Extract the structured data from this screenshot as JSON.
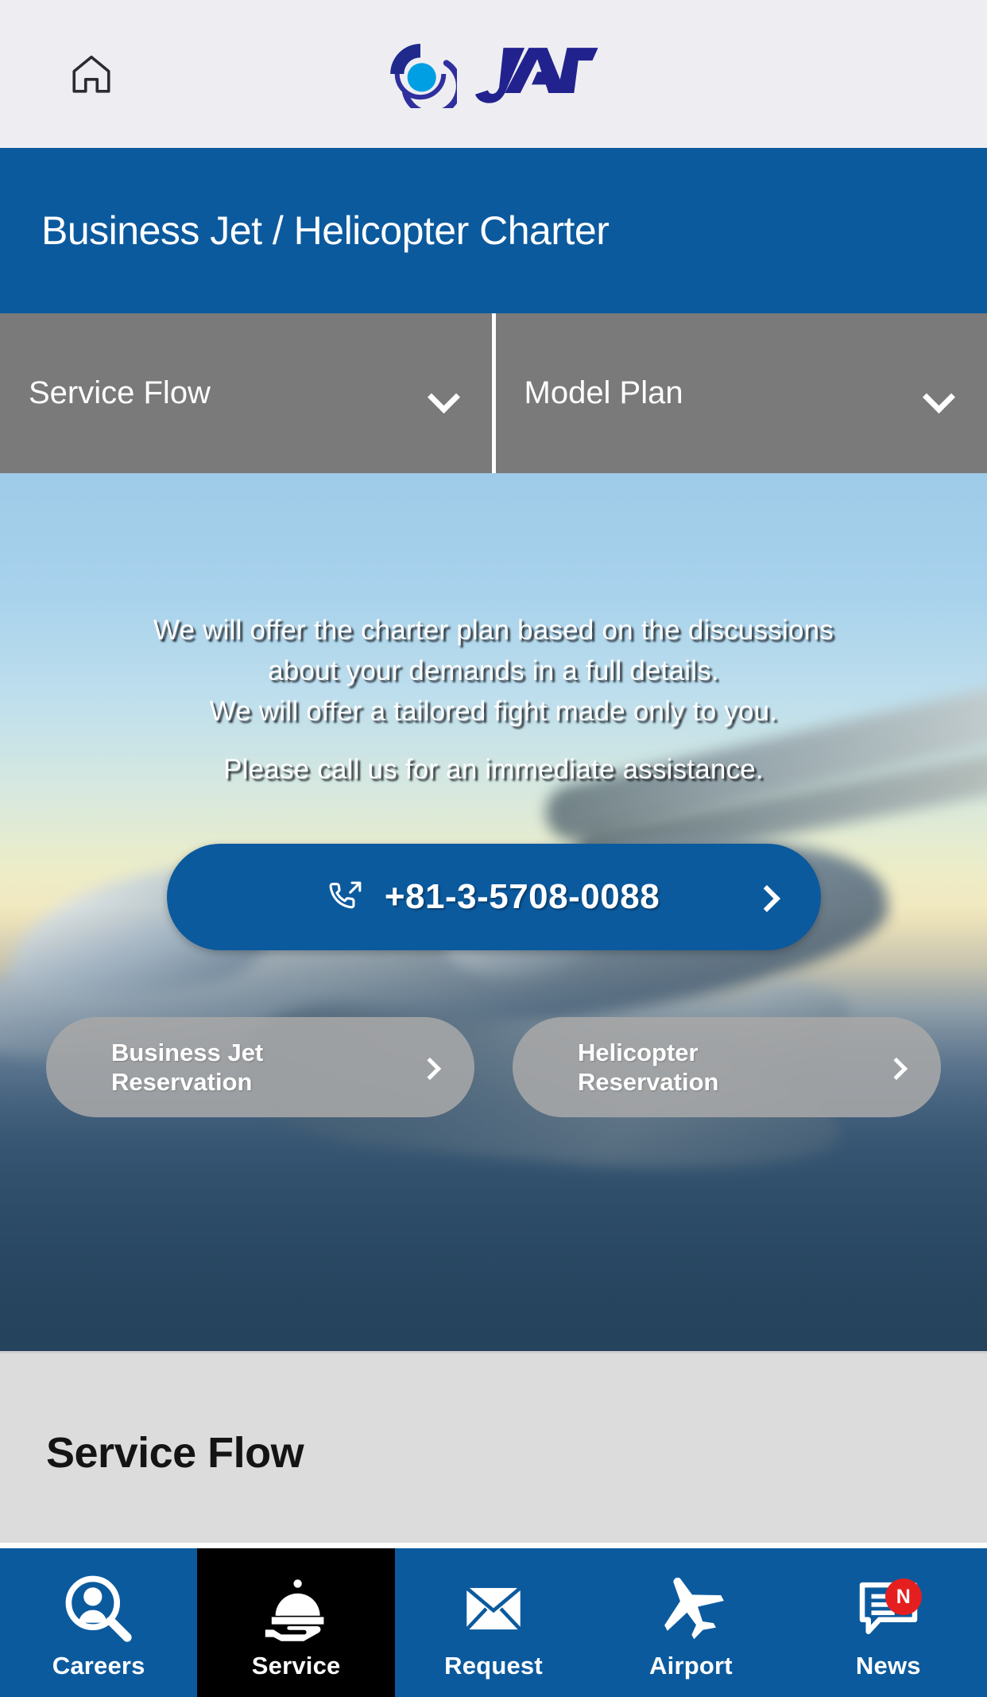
{
  "header": {
    "home_icon": "home-icon",
    "logo_alt": "JAN",
    "logo_mark_color": "#1f2a8c",
    "logo_dot_color": "#009fe3"
  },
  "page_title": "Business Jet / Helicopter Charter",
  "tabs": [
    {
      "label": "Service Flow",
      "icon": "chevron-down-icon"
    },
    {
      "label": "Model Plan",
      "icon": "chevron-down-icon"
    }
  ],
  "hero": {
    "line1": "We will offer the charter plan based on the discussions",
    "line2": "about your demands in a full details.",
    "line3": "We will offer a tailored fight made only to you.",
    "line4": "Please call us for an immediate assistance.",
    "phone": {
      "number": "+81-3-5708-0088",
      "icon": "phone-outgoing-icon",
      "chevron": "chevron-right-icon",
      "color": "#0b5a9e"
    },
    "reservations": [
      {
        "line1": "Business Jet",
        "line2": "Reservation",
        "chevron": "chevron-right-icon"
      },
      {
        "line1": "Helicopter",
        "line2": "Reservation",
        "chevron": "chevron-right-icon"
      }
    ]
  },
  "section": {
    "heading": "Service Flow"
  },
  "bottom_nav": {
    "accent": "#0b5a9e",
    "active_bg": "#000000",
    "items": [
      {
        "label": "Careers",
        "icon": "person-search-icon",
        "active": false,
        "badge": ""
      },
      {
        "label": "Service",
        "icon": "room-service-icon",
        "active": true,
        "badge": ""
      },
      {
        "label": "Request",
        "icon": "envelope-icon",
        "active": false,
        "badge": ""
      },
      {
        "label": "Airport",
        "icon": "airplane-icon",
        "active": false,
        "badge": ""
      },
      {
        "label": "News",
        "icon": "chat-lines-icon",
        "active": false,
        "badge": "N"
      }
    ]
  }
}
